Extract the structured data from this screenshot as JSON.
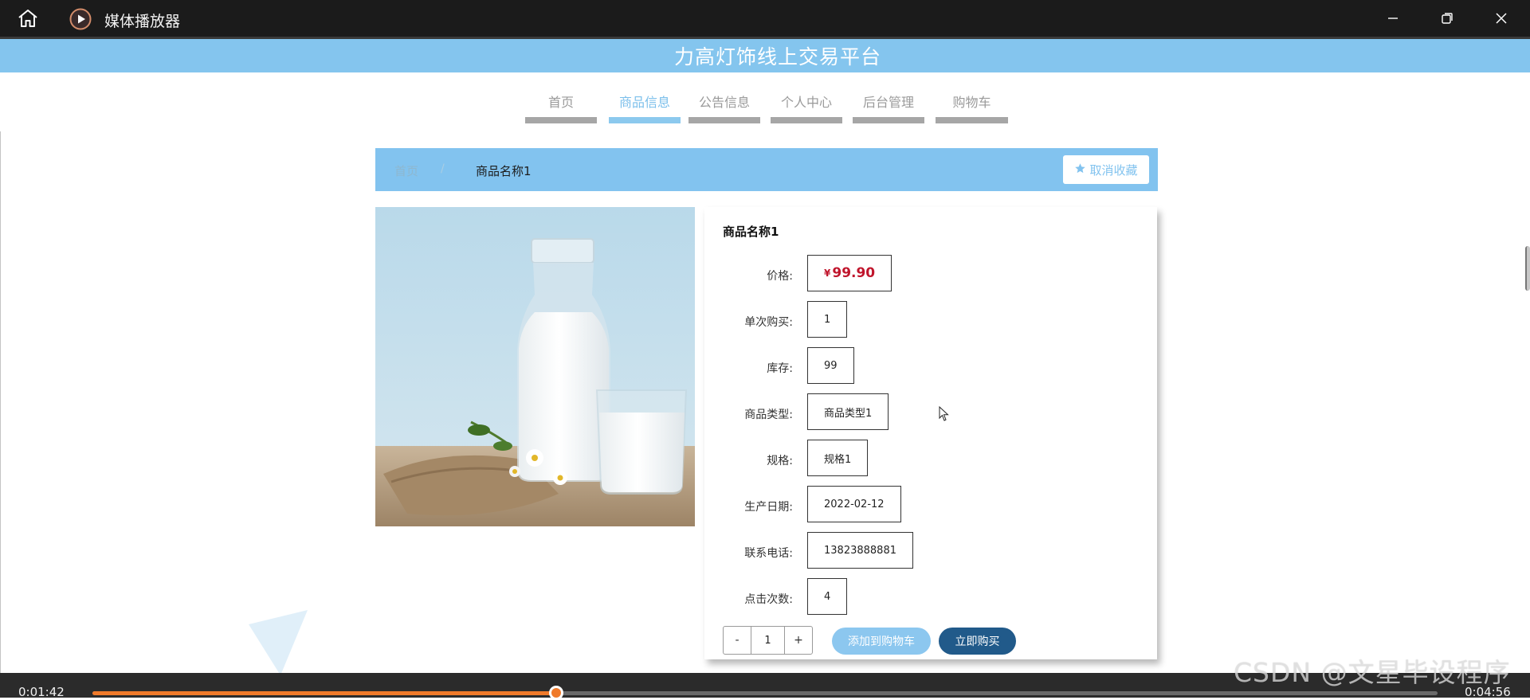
{
  "player": {
    "title": "媒体播放器",
    "current_time": "0:01:42",
    "total_time": "0:04:56",
    "progress": 0.3446
  },
  "site": {
    "title": "力高灯饰线上交易平台"
  },
  "nav": {
    "items": [
      {
        "label": "首页"
      },
      {
        "label": "商品信息",
        "active": true
      },
      {
        "label": "公告信息"
      },
      {
        "label": "个人中心"
      },
      {
        "label": "后台管理"
      },
      {
        "label": "购物车"
      }
    ]
  },
  "breadcrumb": {
    "home": "首页",
    "separator": "/",
    "current": "商品名称1",
    "favorite_label": "取消收藏"
  },
  "product": {
    "name": "商品名称1",
    "price_currency": "¥",
    "price": "99.90",
    "fields": [
      {
        "label": "价格:",
        "value": ""
      },
      {
        "label": "单次购买:",
        "value": "1"
      },
      {
        "label": "库存:",
        "value": "99"
      },
      {
        "label": "商品类型:",
        "value": "商品类型1"
      },
      {
        "label": "规格:",
        "value": "规格1"
      },
      {
        "label": "生产日期:",
        "value": "2022-02-12"
      },
      {
        "label": "联系电话:",
        "value": "13823888881"
      },
      {
        "label": "点击次数:",
        "value": "4"
      }
    ],
    "quantity": {
      "minus": "-",
      "value": "1",
      "plus": "+"
    },
    "add_to_cart_label": "添加到购物车",
    "buy_now_label": "立即购买"
  },
  "watermark": "CSDN @文星毕设程序",
  "colors": {
    "accent": "#84c5ee",
    "price": "#c0152c",
    "buy_button": "#215a8a",
    "seek": "#f07a2a"
  }
}
